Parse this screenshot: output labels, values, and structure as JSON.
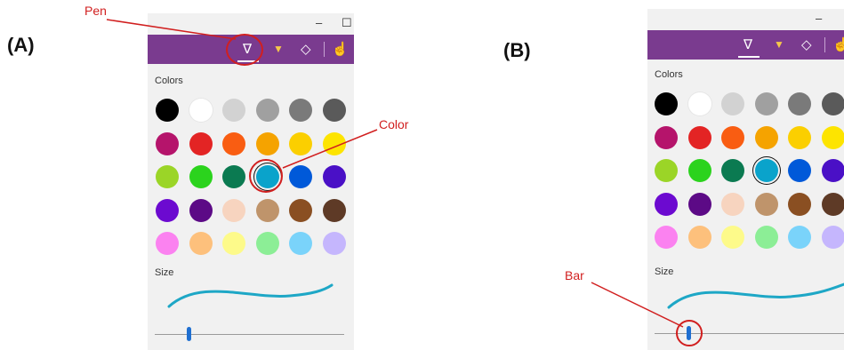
{
  "panels": {
    "a": {
      "label": "(A)"
    },
    "b": {
      "label": "(B)"
    }
  },
  "window": {
    "minimize_glyph": "–",
    "maximize_glyph": "☐"
  },
  "toolbar": {
    "tools": [
      {
        "name": "pen",
        "icon": "pen-icon",
        "glyph": "∇"
      },
      {
        "name": "highlighter",
        "icon": "highlighter-icon",
        "glyph": "▼"
      },
      {
        "name": "eraser",
        "icon": "eraser-icon",
        "glyph": "◇"
      },
      {
        "name": "touch-writing",
        "icon": "touch-writing-icon",
        "glyph": "☝"
      }
    ],
    "active_tool": "pen"
  },
  "colors_label": "Colors",
  "size_label": "Size",
  "palette": [
    [
      "#000000",
      "#ffffff",
      "#d2d2d2",
      "#a0a0a0",
      "#7a7a7a",
      "#5a5a5a"
    ],
    [
      "#b5146b",
      "#e32424",
      "#f95d12",
      "#f5a300",
      "#fbcf00",
      "#fde400"
    ],
    [
      "#9bd527",
      "#2bd31d",
      "#0b7a51",
      "#0aa3cb",
      "#0059d9",
      "#4a10c6"
    ],
    [
      "#6c0ad0",
      "#5c0a86",
      "#f7d4bf",
      "#bf946b",
      "#8a4f22",
      "#5e3a26"
    ],
    [
      "#fb82f0",
      "#fdc07c",
      "#fdfa8a",
      "#8cee96",
      "#7ad3fa",
      "#c5b6fd"
    ]
  ],
  "selected_color": "#0aa3cb",
  "size_slider": {
    "value": 0.18
  },
  "stroke_color": "#1ea7c6",
  "callouts": {
    "pen": "Pen",
    "color": "Color",
    "bar": "Bar"
  },
  "accent_color": "#7a3b8f",
  "annotation_color": "#d11f1f"
}
